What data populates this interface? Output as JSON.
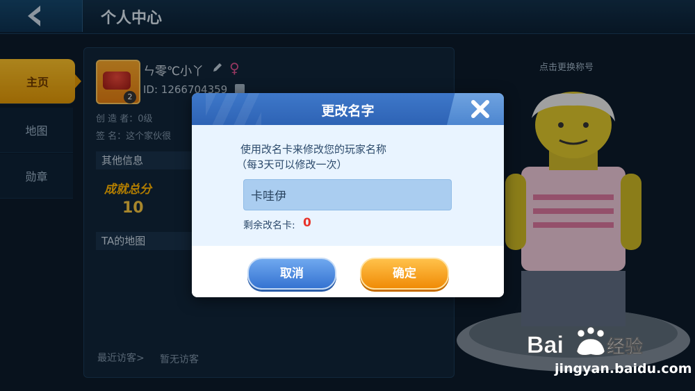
{
  "header": {
    "title": "个人中心"
  },
  "sidebar": {
    "items": [
      {
        "label": "主页"
      },
      {
        "label": "地图"
      },
      {
        "label": "勋章"
      }
    ]
  },
  "profile": {
    "name": "ㄣ零℃小丫",
    "id": "ID: 1266704359",
    "level": "2",
    "creator": "创 造 者：0级",
    "signature": "签    名：这个家伙很",
    "other_info": "其他信息",
    "score_label": "成就总分",
    "score_value": "10",
    "map_section": "TA的地图",
    "visitor_label": "最近访客>",
    "visitor_value": "暂无访客"
  },
  "character": {
    "change_title": "点击更换称号"
  },
  "dialog": {
    "title": "更改名字",
    "desc_line1": "使用改名卡来修改您的玩家名称",
    "desc_line2": "（每3天可以修改一次）",
    "input_value": "卡哇伊",
    "remaining_label": "剩余改名卡:",
    "remaining_value": "0",
    "cancel_label": "取消",
    "confirm_label": "确定"
  },
  "watermark": {
    "logo_text": "Bai du 经验",
    "url": "jingyan.baidu.com"
  },
  "colors": {
    "accent": "#2e63b5",
    "confirm": "#f08b06",
    "remaining": "#e8332a"
  }
}
